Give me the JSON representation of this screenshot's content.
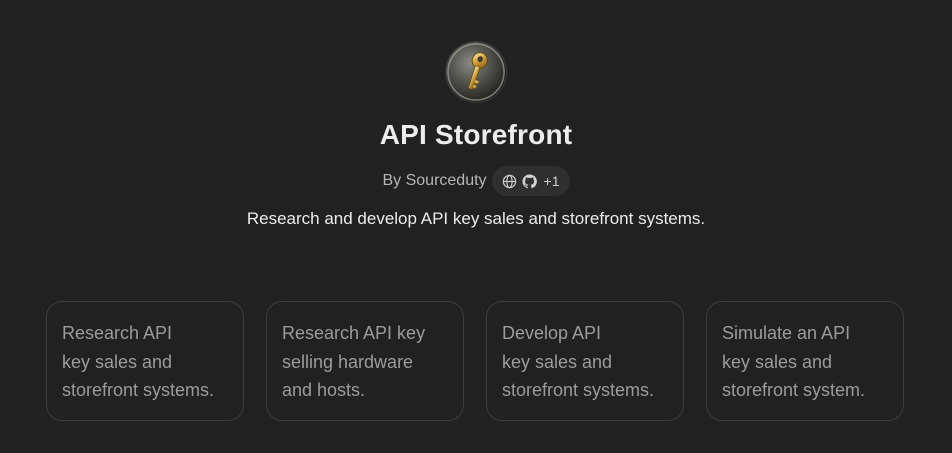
{
  "gpt": {
    "avatar_icon": "key-icon",
    "title": "API Storefront",
    "byline": {
      "author": "By Sourceduty",
      "icons": [
        "globe-icon",
        "github-icon"
      ],
      "extra_count": "+1"
    },
    "description": "Research and develop API key sales and storefront systems."
  },
  "starter_prompts": [
    {
      "lines": [
        "Research API",
        "key sales and",
        "storefront systems."
      ]
    },
    {
      "lines": [
        "Research API key",
        "selling hardware",
        "and hosts."
      ]
    },
    {
      "lines": [
        "Develop API",
        "key sales and",
        "storefront systems."
      ]
    },
    {
      "lines": [
        "Simulate an API",
        "key sales and",
        "storefront system."
      ]
    }
  ],
  "colors": {
    "background": "#212121",
    "card_border": "#3d3d3d",
    "card_text": "#9b9b9b",
    "title_text": "#ececec",
    "badge_bg": "#2f2f2f"
  }
}
